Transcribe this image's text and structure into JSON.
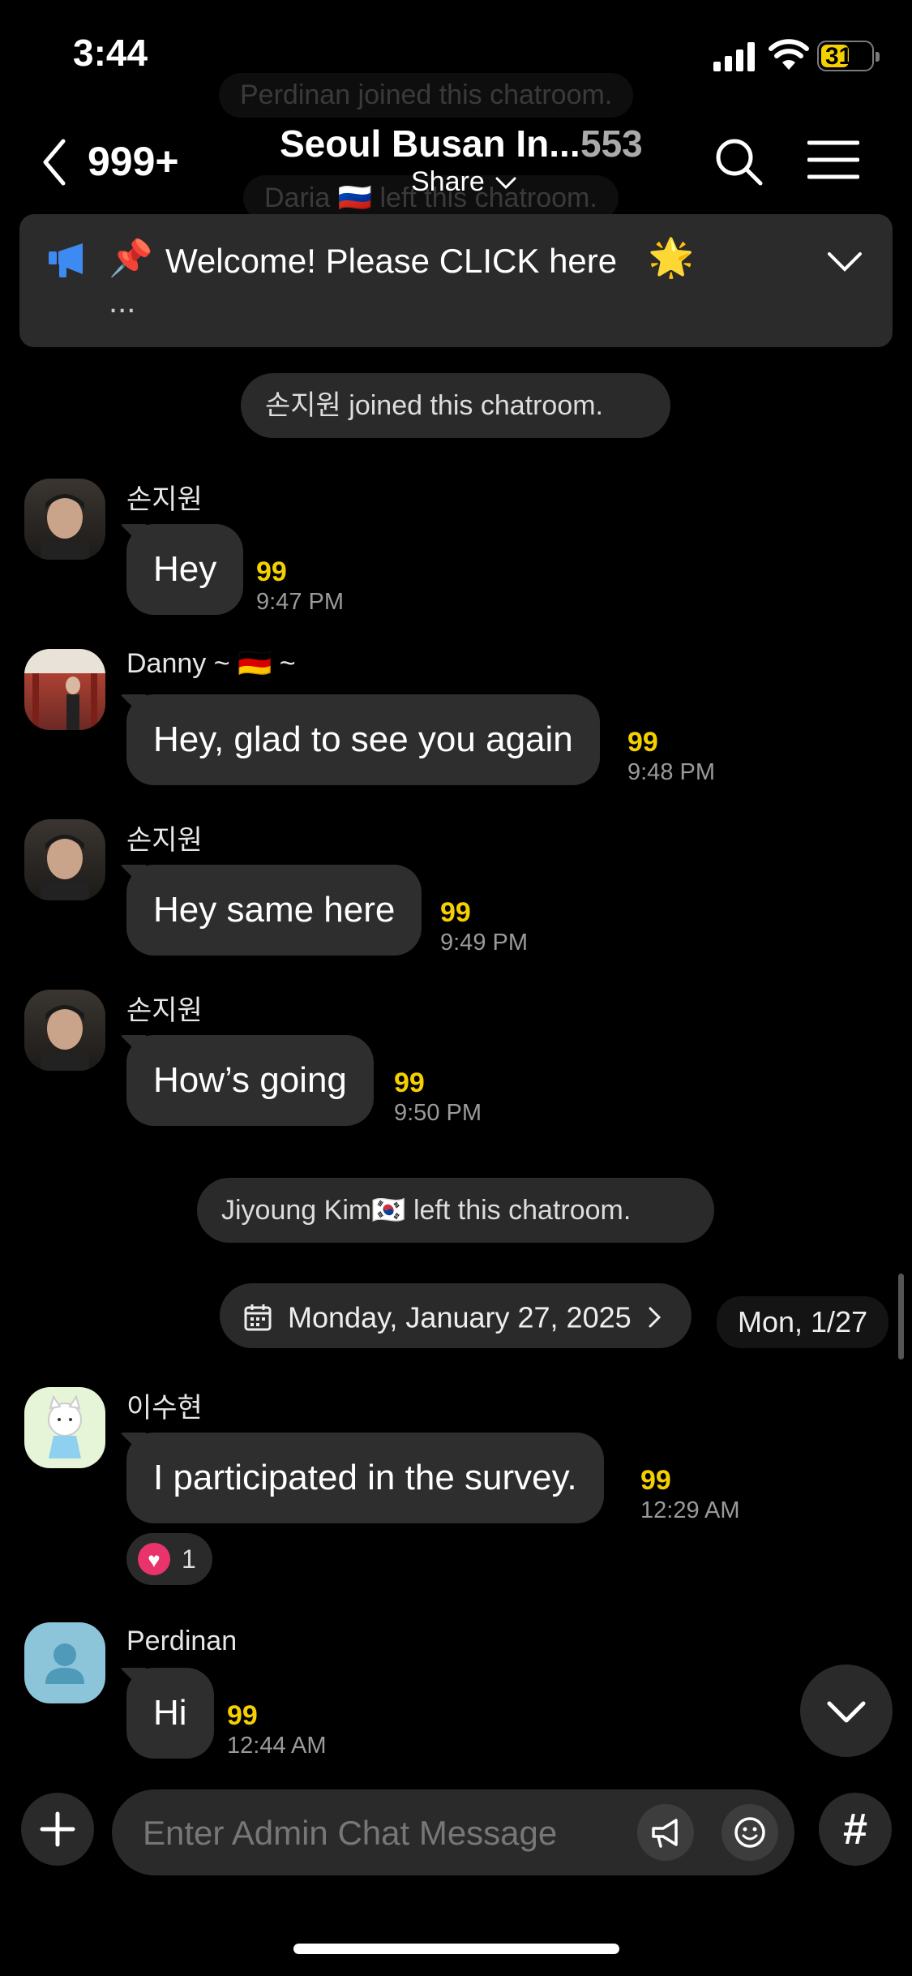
{
  "status_bar": {
    "time": "3:44",
    "battery": "31"
  },
  "background_system": [
    "Perdinan  joined this chatroom.",
    "Daria 🇷🇺 left this chatroom."
  ],
  "header": {
    "back_count": "999+",
    "title": "Seoul Busan In...",
    "member_count": "553",
    "share_label": "Share"
  },
  "notice": {
    "pin_emoji": "📌",
    "text": "Welcome! Please CLICK here",
    "star_emoji": "🌟",
    "ellipsis": "..."
  },
  "system_messages": {
    "joined": "손지원  joined this chatroom.",
    "left": "Jiyoung Kim🇰🇷 left this chatroom."
  },
  "messages": [
    {
      "sender": "손지원",
      "text": "Hey",
      "unread": "99",
      "time": "9:47 PM"
    },
    {
      "sender": "Danny ~ 🇩🇪 ~",
      "text": "Hey, glad to see you again",
      "unread": "99",
      "time": "9:48 PM"
    },
    {
      "sender": "손지원",
      "text": "Hey same here",
      "unread": "99",
      "time": "9:49 PM"
    },
    {
      "sender": "손지원",
      "text": "How’s going",
      "unread": "99",
      "time": "9:50 PM"
    },
    {
      "sender": "이수현",
      "text": "I participated in the survey.",
      "unread": "99",
      "time": "12:29 AM",
      "reaction_count": "1"
    },
    {
      "sender": "Perdinan",
      "text": "Hi",
      "unread": "99",
      "time": "12:44 AM"
    }
  ],
  "date_divider": "Monday, January 27, 2025",
  "date_tag": "Mon, 1/27",
  "composer": {
    "placeholder": "Enter Admin Chat Message",
    "hash": "#"
  },
  "colors": {
    "unread": "#f5d000",
    "bubble": "#2e2e2e",
    "background": "#000000",
    "megaphone": "#3d8bf2",
    "heart": "#e8336b"
  },
  "icons": [
    "back-arrow-icon",
    "search-icon",
    "menu-icon",
    "megaphone-icon",
    "chevron-down-icon",
    "calendar-icon",
    "chevron-right-icon",
    "heart-icon",
    "plus-icon",
    "announce-icon",
    "emoji-icon",
    "hash-icon"
  ]
}
